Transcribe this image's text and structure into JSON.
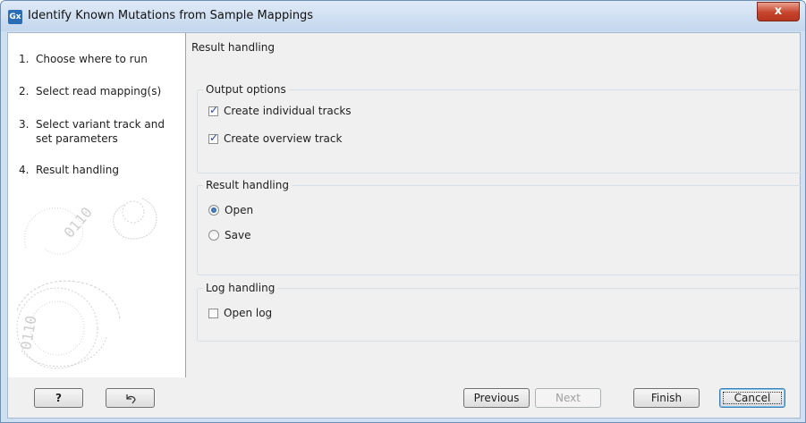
{
  "window": {
    "title": "Identify Known Mutations from Sample Mappings",
    "app_icon_text": "Gx",
    "close_label": "x"
  },
  "steps": [
    {
      "num": "1.",
      "label": "Choose where to run"
    },
    {
      "num": "2.",
      "label": "Select read mapping(s)"
    },
    {
      "num": "3.",
      "label": "Select variant track and set parameters"
    },
    {
      "num": "4.",
      "label": "Result handling"
    }
  ],
  "content": {
    "section_title": "Result handling",
    "output_options": {
      "title": "Output options",
      "individual_tracks": {
        "label": "Create individual tracks",
        "checked": true
      },
      "overview_track": {
        "label": "Create overview track",
        "checked": true
      }
    },
    "result_handling": {
      "title": "Result handling",
      "open": {
        "label": "Open",
        "selected": true
      },
      "save": {
        "label": "Save",
        "selected": false
      }
    },
    "log_handling": {
      "title": "Log handling",
      "open_log": {
        "label": "Open log",
        "checked": false
      }
    }
  },
  "footer": {
    "help_label": "?",
    "reset_icon": "reset-arrow-icon",
    "previous_label": "Previous",
    "next_label": "Next",
    "finish_label": "Finish",
    "cancel_label": "Cancel"
  }
}
